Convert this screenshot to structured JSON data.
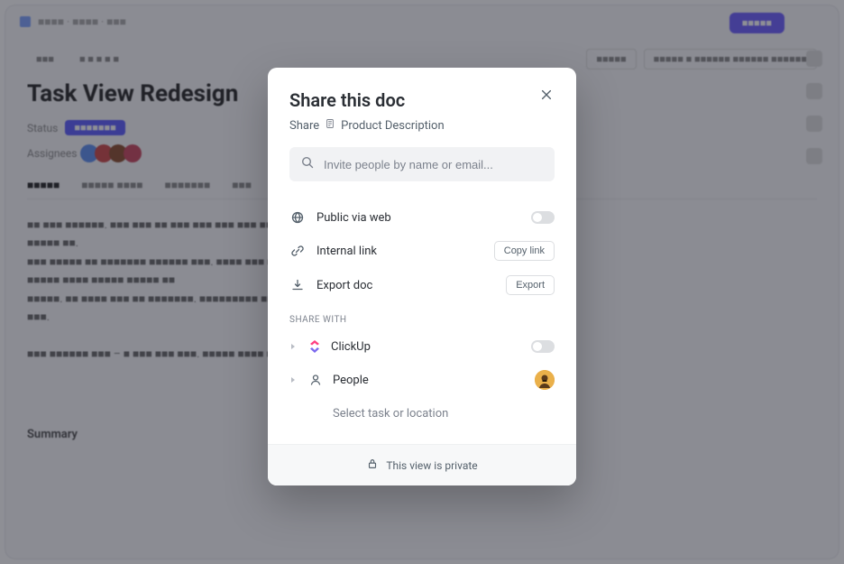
{
  "backdrop": {
    "title": "Task View Redesign",
    "status_label": "Status",
    "status_value": "IN PROGRESS",
    "assignees_label": "Assignees",
    "tabs": [
      "Details",
      "Custom Fields",
      "Subtasks",
      "Docs"
    ],
    "subtitle": "Summary"
  },
  "modal": {
    "title": "Share this doc",
    "share_label": "Share",
    "doc_name": "Product Description",
    "search_placeholder": "Invite people by name or email...",
    "options": {
      "public_web": "Public via web",
      "internal_link": "Internal link",
      "export_doc": "Export doc",
      "copy_link_btn": "Copy link",
      "export_btn": "Export"
    },
    "share_with_label": "SHARE WITH",
    "share_items": {
      "clickup": "ClickUp",
      "people": "People",
      "select_task": "Select task or location"
    },
    "footer": "This view is private"
  }
}
